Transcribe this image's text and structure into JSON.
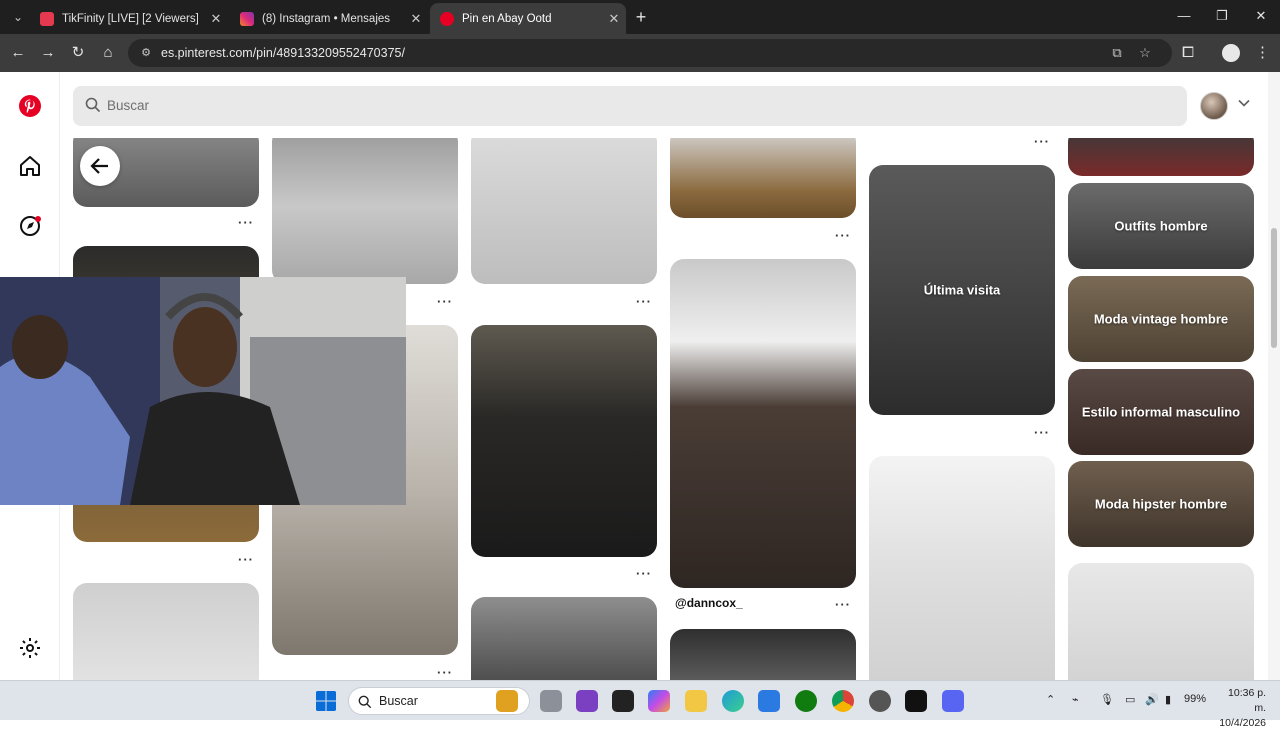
{
  "browser": {
    "tabs": [
      {
        "title": "TikFinity [LIVE] [2 Viewers]",
        "active": false,
        "icon": "tikfinity-icon"
      },
      {
        "title": "(8) Instagram • Mensajes",
        "active": false,
        "icon": "instagram-icon"
      },
      {
        "title": "Pin en Abay Ootd",
        "active": true,
        "icon": "pinterest-icon"
      }
    ],
    "url": "es.pinterest.com/pin/489133209552470375/"
  },
  "pinterest": {
    "search_placeholder": "Buscar",
    "brand_color": "#e60023",
    "sidebar": [
      "pinterest-logo-icon",
      "home-icon",
      "explore-icon",
      "settings-icon"
    ]
  },
  "pins": {
    "author": "@danncox_",
    "last_visit": "Última visita",
    "boards": [
      "Outfits hombre",
      "Moda vintage hombre",
      "Estilo informal masculino",
      "Moda hipster hombre"
    ],
    "more_label": "···"
  },
  "taskbar": {
    "search": "Buscar",
    "battery": "99%",
    "time": "10:36 p. m.",
    "date": "10/4/2026"
  }
}
